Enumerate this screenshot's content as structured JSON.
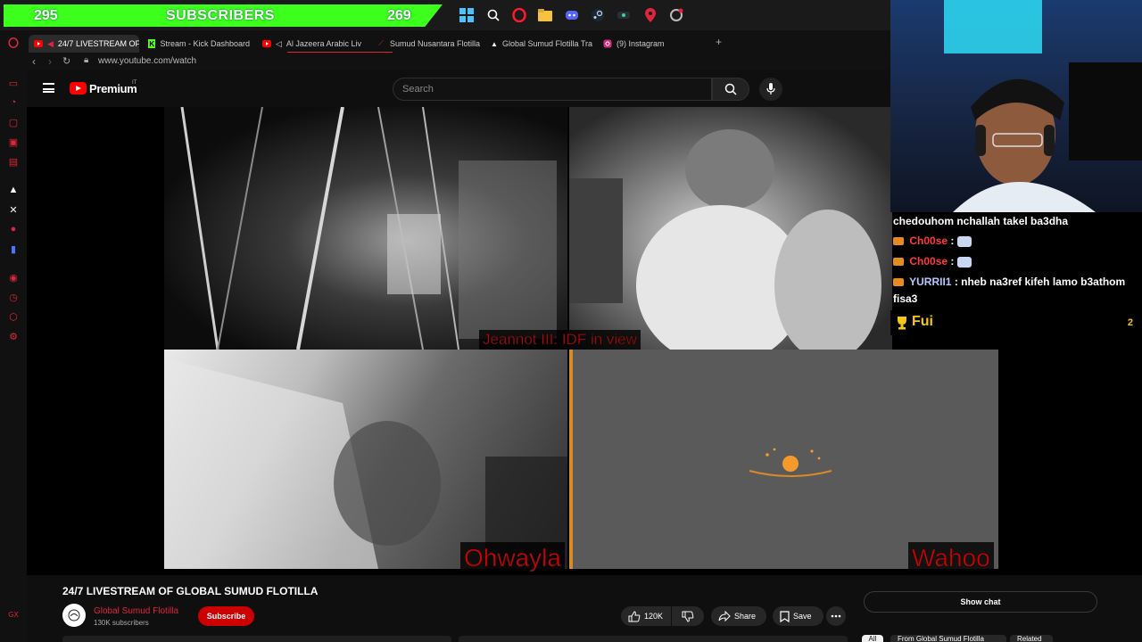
{
  "taskbar": {
    "subscribers_left": "295",
    "subscribers_label": "SUBSCRIBERS",
    "subscribers_right": "269",
    "icons": [
      "windows-icon",
      "search-icon",
      "opera-icon",
      "folder-icon",
      "discord-icon",
      "steam-icon",
      "app-icon",
      "maps-pin-icon",
      "settings-icon"
    ]
  },
  "tabs": [
    {
      "label": "24/7 LIVESTREAM OF",
      "favicon": "youtube-icon",
      "active": true
    },
    {
      "label": "Stream - Kick Dashboard",
      "favicon": "kick-icon"
    },
    {
      "label": "Al Jazeera Arabic Liv",
      "favicon": "youtube-icon"
    },
    {
      "label": "Sumud Nusantara Flotilla",
      "favicon": "flotilla-icon"
    },
    {
      "label": "Global Sumud Flotilla Tra",
      "favicon": "triangle-icon"
    },
    {
      "label": "(9) Instagram",
      "favicon": "instagram-icon"
    }
  ],
  "addressbar": {
    "url": "www.youtube.com/watch"
  },
  "youtube": {
    "brand": "Premium",
    "country": "IT",
    "search_placeholder": "Search"
  },
  "player": {
    "captions": {
      "cam1": "Jeannot III: IDF in view",
      "cam3": "Ohwayla",
      "cam4": "Wahoo"
    }
  },
  "chat": {
    "lines": [
      {
        "user": "",
        "text": "chedouhom nchallah takel ba3dha"
      },
      {
        "user": "Ch00se",
        "text": ":"
      },
      {
        "user": "Ch00se",
        "text": ":"
      },
      {
        "user": "YURRII1",
        "text": ": nheb na3ref kifeh lamo b3athom"
      },
      {
        "user": "",
        "text": "fisa3"
      }
    ],
    "footer_label": "Fui",
    "footer_count": "2"
  },
  "video": {
    "title": "24/7 LIVESTREAM OF GLOBAL SUMUD FLOTILLA",
    "channel": "Global Sumud Flotilla",
    "subscribers": "130K subscribers",
    "subscribe_label": "Subscribe",
    "like_count": "120K",
    "share_label": "Share",
    "save_label": "Save",
    "show_chat_label": "Show chat",
    "chips": [
      "All",
      "From Global Sumud Flotilla",
      "Related"
    ]
  },
  "colors": {
    "accent": "#e0243b",
    "subscriber_bar": "#3cff1e",
    "caption_red": "#d10000",
    "youtube_red": "#ff0000"
  }
}
